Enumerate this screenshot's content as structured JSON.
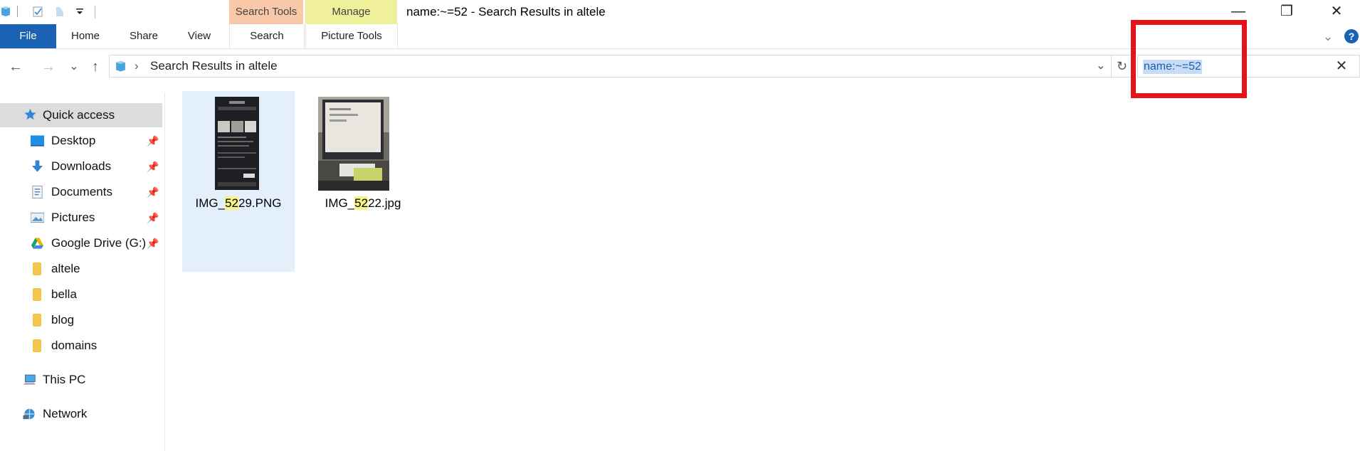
{
  "window": {
    "title": "name:~=52 - Search Results in altele",
    "minimize_label": "—",
    "restore_label": "❐",
    "close_label": "✕"
  },
  "context_tabs": {
    "search_tools": "Search Tools",
    "manage": "Manage"
  },
  "ribbon": {
    "tabs": [
      "File",
      "Home",
      "Share",
      "View",
      "Search",
      "Picture Tools"
    ],
    "collapse_label": "⌄",
    "help_label": "?"
  },
  "navigation": {
    "back": "←",
    "forward": "→",
    "recent": "⌄",
    "up": "↑",
    "breadcrumb_sep": "›",
    "address": "Search Results in altele",
    "address_dropdown": "⌄",
    "refresh": "↻"
  },
  "search": {
    "value": "name:~=52",
    "clear_label": "✕"
  },
  "sidebar": {
    "quick_access": "Quick access",
    "items": [
      {
        "label": "Desktop",
        "pinned": true,
        "icon": "desktop-icon"
      },
      {
        "label": "Downloads",
        "pinned": true,
        "icon": "download-icon"
      },
      {
        "label": "Documents",
        "pinned": true,
        "icon": "document-icon"
      },
      {
        "label": "Pictures",
        "pinned": true,
        "icon": "pictures-icon"
      },
      {
        "label": "Google Drive (G:)",
        "pinned": true,
        "icon": "google-drive-icon"
      },
      {
        "label": "altele",
        "pinned": false,
        "icon": "folder-icon"
      },
      {
        "label": "bella",
        "pinned": false,
        "icon": "folder-icon"
      },
      {
        "label": "blog",
        "pinned": false,
        "icon": "folder-icon"
      },
      {
        "label": "domains",
        "pinned": false,
        "icon": "folder-icon"
      }
    ],
    "pin_glyph": "📌",
    "this_pc": "This PC",
    "network": "Network"
  },
  "files": [
    {
      "prefix": "IMG_",
      "match": "52",
      "suffix": "29.PNG",
      "selected": true
    },
    {
      "prefix": "IMG_",
      "match": "52",
      "suffix": "22.jpg",
      "selected": false
    }
  ],
  "colors": {
    "file_tab": "#1a63b4",
    "search_tools_tab": "#f8c8a8",
    "manage_tab": "#f0f09a",
    "highlight_box": "#e4141b",
    "selection": "#e3f0fb",
    "match_highlight": "#f8f48a"
  }
}
